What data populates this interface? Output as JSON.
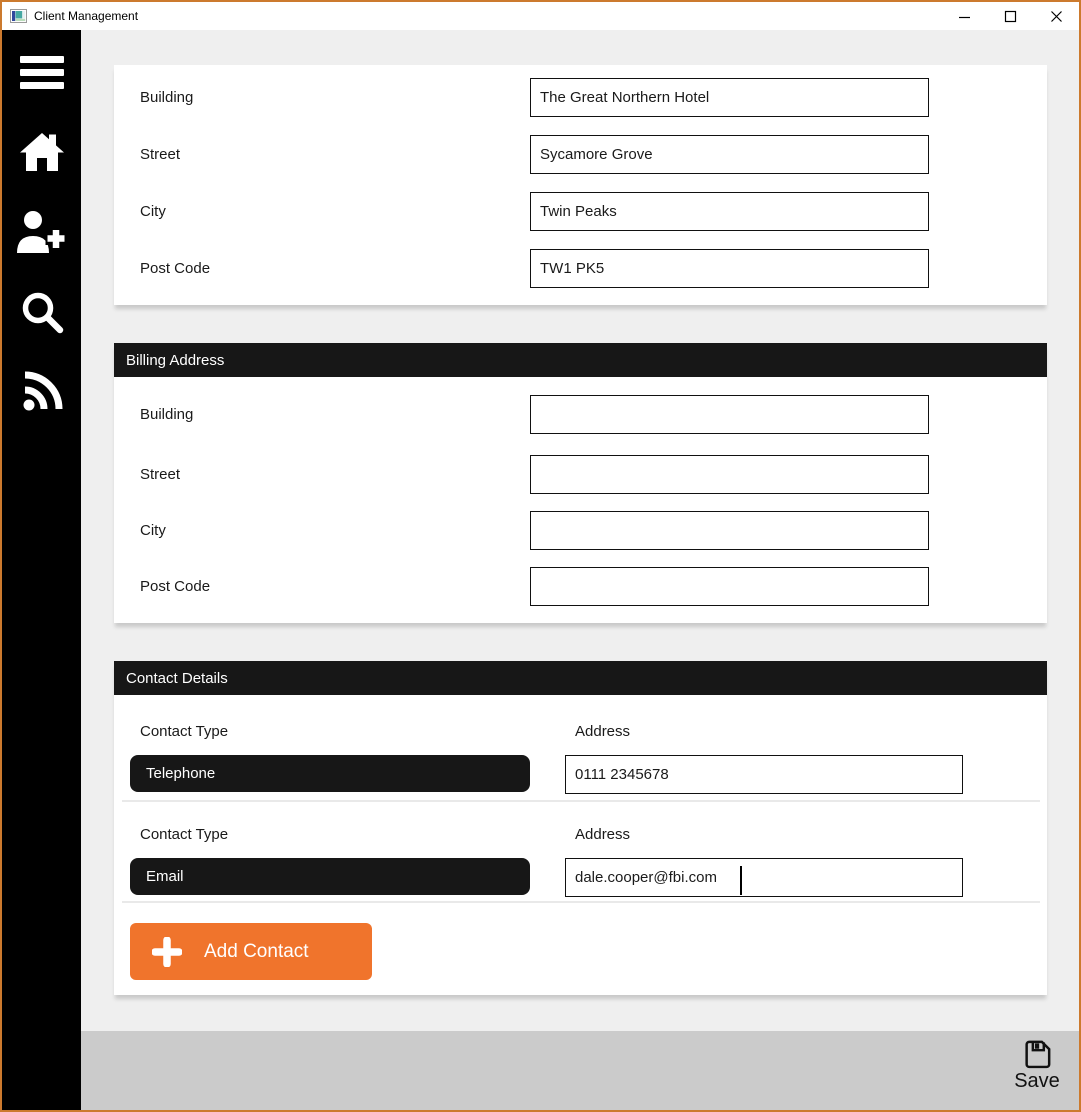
{
  "window": {
    "title": "Client Management"
  },
  "sidebar": {
    "items": [
      {
        "icon": "menu-icon"
      },
      {
        "icon": "home-icon"
      },
      {
        "icon": "add-client-icon"
      },
      {
        "icon": "search-icon"
      },
      {
        "icon": "feed-icon"
      }
    ]
  },
  "address_section": {
    "fields": [
      {
        "label": "Building",
        "value": "The Great Northern Hotel"
      },
      {
        "label": "Street",
        "value": "Sycamore Grove"
      },
      {
        "label": "City",
        "value": "Twin Peaks"
      },
      {
        "label": "Post Code",
        "value": "TW1 PK5"
      }
    ]
  },
  "billing_section": {
    "title": "Billing Address",
    "fields": [
      {
        "label": "Building",
        "value": ""
      },
      {
        "label": "Street",
        "value": ""
      },
      {
        "label": "City",
        "value": ""
      },
      {
        "label": "Post Code",
        "value": ""
      }
    ]
  },
  "contacts_section": {
    "title": "Contact Details",
    "contact_type_label": "Contact Type",
    "address_label": "Address",
    "contacts": [
      {
        "type": "Telephone",
        "address": "0111 2345678"
      },
      {
        "type": "Email",
        "address": "dale.cooper@fbi.com"
      }
    ],
    "add_button_label": "Add Contact"
  },
  "footer": {
    "save_label": "Save"
  },
  "colors": {
    "accent_orange": "#F0742C",
    "window_border": "#CC7A2E",
    "panel_header_black": "#171717",
    "footer_bar_gray": "#CBCBCB",
    "background_gray": "#EFEFEF"
  }
}
